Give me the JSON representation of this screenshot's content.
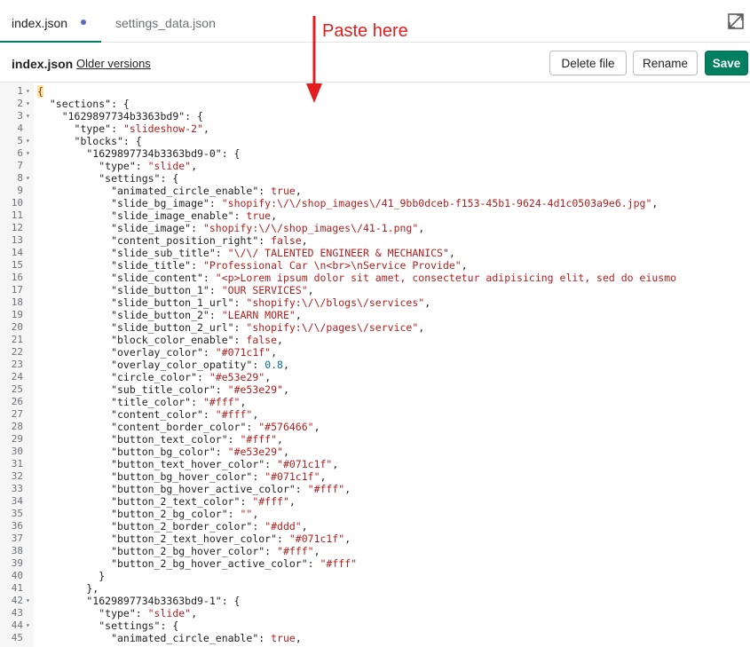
{
  "tabs": [
    {
      "label": "index.json",
      "active": true,
      "modified": true
    },
    {
      "label": "settings_data.json",
      "active": false
    }
  ],
  "toolbar": {
    "filename": "index.json",
    "older_versions": "Older versions",
    "delete_label": "Delete file",
    "rename_label": "Rename",
    "save_label": "Save"
  },
  "annotation": {
    "text": "Paste here",
    "color": "#e11d1d"
  },
  "colors": {
    "accent": "#008060",
    "string": "#b31d1d",
    "number": "#0a6e8a",
    "dot": "#5c6ac4"
  },
  "code_lines": [
    {
      "n": "1",
      "fold": true,
      "parts": [
        [
          "b",
          "{"
        ]
      ]
    },
    {
      "n": "2",
      "fold": true,
      "parts": [
        [
          "k",
          "  \"sections\": {"
        ]
      ]
    },
    {
      "n": "3",
      "fold": true,
      "parts": [
        [
          "k",
          "    \"1629897734b3363bd9\": {"
        ]
      ]
    },
    {
      "n": "4",
      "fold": false,
      "parts": [
        [
          "k",
          "      \"type\": "
        ],
        [
          "s",
          "\"slideshow-2\""
        ],
        [
          "k",
          ","
        ]
      ]
    },
    {
      "n": "5",
      "fold": true,
      "parts": [
        [
          "k",
          "      \"blocks\": {"
        ]
      ]
    },
    {
      "n": "6",
      "fold": true,
      "parts": [
        [
          "k",
          "        \"1629897734b3363bd9-0\": {"
        ]
      ]
    },
    {
      "n": "7",
      "fold": false,
      "parts": [
        [
          "k",
          "          \"type\": "
        ],
        [
          "s",
          "\"slide\""
        ],
        [
          "k",
          ","
        ]
      ]
    },
    {
      "n": "8",
      "fold": true,
      "parts": [
        [
          "k",
          "          \"settings\": {"
        ]
      ]
    },
    {
      "n": "9",
      "fold": false,
      "parts": [
        [
          "k",
          "            \"animated_circle_enable\": "
        ],
        [
          "b",
          "true"
        ],
        [
          "k",
          ","
        ]
      ]
    },
    {
      "n": "10",
      "fold": false,
      "parts": [
        [
          "k",
          "            \"slide_bg_image\": "
        ],
        [
          "s",
          "\"shopify:\\/\\/shop_images\\/41_9bb0dceb-f153-45b1-9624-4d1c0503a9e6.jpg\""
        ],
        [
          "k",
          ","
        ]
      ]
    },
    {
      "n": "11",
      "fold": false,
      "parts": [
        [
          "k",
          "            \"slide_image_enable\": "
        ],
        [
          "b",
          "true"
        ],
        [
          "k",
          ","
        ]
      ]
    },
    {
      "n": "12",
      "fold": false,
      "parts": [
        [
          "k",
          "            \"slide_image\": "
        ],
        [
          "s",
          "\"shopify:\\/\\/shop_images\\/41-1.png\""
        ],
        [
          "k",
          ","
        ]
      ]
    },
    {
      "n": "13",
      "fold": false,
      "parts": [
        [
          "k",
          "            \"content_position_right\": "
        ],
        [
          "b",
          "false"
        ],
        [
          "k",
          ","
        ]
      ]
    },
    {
      "n": "14",
      "fold": false,
      "parts": [
        [
          "k",
          "            \"slide_sub_title\": "
        ],
        [
          "s",
          "\"\\/\\/ TALENTED ENGINEER & MECHANICS\""
        ],
        [
          "k",
          ","
        ]
      ]
    },
    {
      "n": "15",
      "fold": false,
      "parts": [
        [
          "k",
          "            \"slide_title\": "
        ],
        [
          "s",
          "\"Professional Car \\n<br>\\nService Provide\""
        ],
        [
          "k",
          ","
        ]
      ]
    },
    {
      "n": "16",
      "fold": false,
      "parts": [
        [
          "k",
          "            \"slide_content\": "
        ],
        [
          "s",
          "\"<p>Lorem ipsum dolor sit amet, consectetur adipisicing elit, sed do eiusmo"
        ]
      ]
    },
    {
      "n": "17",
      "fold": false,
      "parts": [
        [
          "k",
          "            \"slide_button_1\": "
        ],
        [
          "s",
          "\"OUR SERVICES\""
        ],
        [
          "k",
          ","
        ]
      ]
    },
    {
      "n": "18",
      "fold": false,
      "parts": [
        [
          "k",
          "            \"slide_button_1_url\": "
        ],
        [
          "s",
          "\"shopify:\\/\\/blogs\\/services\""
        ],
        [
          "k",
          ","
        ]
      ]
    },
    {
      "n": "19",
      "fold": false,
      "parts": [
        [
          "k",
          "            \"slide_button_2\": "
        ],
        [
          "s",
          "\"LEARN MORE\""
        ],
        [
          "k",
          ","
        ]
      ]
    },
    {
      "n": "20",
      "fold": false,
      "parts": [
        [
          "k",
          "            \"slide_button_2_url\": "
        ],
        [
          "s",
          "\"shopify:\\/\\/pages\\/service\""
        ],
        [
          "k",
          ","
        ]
      ]
    },
    {
      "n": "21",
      "fold": false,
      "parts": [
        [
          "k",
          "            \"block_color_enable\": "
        ],
        [
          "b",
          "false"
        ],
        [
          "k",
          ","
        ]
      ]
    },
    {
      "n": "22",
      "fold": false,
      "parts": [
        [
          "k",
          "            \"overlay_color\": "
        ],
        [
          "s",
          "\"#071c1f\""
        ],
        [
          "k",
          ","
        ]
      ]
    },
    {
      "n": "23",
      "fold": false,
      "parts": [
        [
          "k",
          "            \"overlay_color_opatity\": "
        ],
        [
          "n",
          "0.8"
        ],
        [
          "k",
          ","
        ]
      ]
    },
    {
      "n": "24",
      "fold": false,
      "parts": [
        [
          "k",
          "            \"circle_color\": "
        ],
        [
          "s",
          "\"#e53e29\""
        ],
        [
          "k",
          ","
        ]
      ]
    },
    {
      "n": "25",
      "fold": false,
      "parts": [
        [
          "k",
          "            \"sub_title_color\": "
        ],
        [
          "s",
          "\"#e53e29\""
        ],
        [
          "k",
          ","
        ]
      ]
    },
    {
      "n": "26",
      "fold": false,
      "parts": [
        [
          "k",
          "            \"title_color\": "
        ],
        [
          "s",
          "\"#fff\""
        ],
        [
          "k",
          ","
        ]
      ]
    },
    {
      "n": "27",
      "fold": false,
      "parts": [
        [
          "k",
          "            \"content_color\": "
        ],
        [
          "s",
          "\"#fff\""
        ],
        [
          "k",
          ","
        ]
      ]
    },
    {
      "n": "28",
      "fold": false,
      "parts": [
        [
          "k",
          "            \"content_border_color\": "
        ],
        [
          "s",
          "\"#576466\""
        ],
        [
          "k",
          ","
        ]
      ]
    },
    {
      "n": "29",
      "fold": false,
      "parts": [
        [
          "k",
          "            \"button_text_color\": "
        ],
        [
          "s",
          "\"#fff\""
        ],
        [
          "k",
          ","
        ]
      ]
    },
    {
      "n": "30",
      "fold": false,
      "parts": [
        [
          "k",
          "            \"button_bg_color\": "
        ],
        [
          "s",
          "\"#e53e29\""
        ],
        [
          "k",
          ","
        ]
      ]
    },
    {
      "n": "31",
      "fold": false,
      "parts": [
        [
          "k",
          "            \"button_text_hover_color\": "
        ],
        [
          "s",
          "\"#071c1f\""
        ],
        [
          "k",
          ","
        ]
      ]
    },
    {
      "n": "32",
      "fold": false,
      "parts": [
        [
          "k",
          "            \"button_bg_hover_color\": "
        ],
        [
          "s",
          "\"#071c1f\""
        ],
        [
          "k",
          ","
        ]
      ]
    },
    {
      "n": "33",
      "fold": false,
      "parts": [
        [
          "k",
          "            \"button_bg_hover_active_color\": "
        ],
        [
          "s",
          "\"#fff\""
        ],
        [
          "k",
          ","
        ]
      ]
    },
    {
      "n": "34",
      "fold": false,
      "parts": [
        [
          "k",
          "            \"button_2_text_color\": "
        ],
        [
          "s",
          "\"#fff\""
        ],
        [
          "k",
          ","
        ]
      ]
    },
    {
      "n": "35",
      "fold": false,
      "parts": [
        [
          "k",
          "            \"button_2_bg_color\": "
        ],
        [
          "s",
          "\"\""
        ],
        [
          "k",
          ","
        ]
      ]
    },
    {
      "n": "36",
      "fold": false,
      "parts": [
        [
          "k",
          "            \"button_2_border_color\": "
        ],
        [
          "s",
          "\"#ddd\""
        ],
        [
          "k",
          ","
        ]
      ]
    },
    {
      "n": "37",
      "fold": false,
      "parts": [
        [
          "k",
          "            \"button_2_text_hover_color\": "
        ],
        [
          "s",
          "\"#071c1f\""
        ],
        [
          "k",
          ","
        ]
      ]
    },
    {
      "n": "38",
      "fold": false,
      "parts": [
        [
          "k",
          "            \"button_2_bg_hover_color\": "
        ],
        [
          "s",
          "\"#fff\""
        ],
        [
          "k",
          ","
        ]
      ]
    },
    {
      "n": "39",
      "fold": false,
      "parts": [
        [
          "k",
          "            \"button_2_bg_hover_active_color\": "
        ],
        [
          "s",
          "\"#fff\""
        ]
      ]
    },
    {
      "n": "40",
      "fold": false,
      "parts": [
        [
          "k",
          "          }"
        ]
      ]
    },
    {
      "n": "41",
      "fold": false,
      "parts": [
        [
          "k",
          "        },"
        ]
      ]
    },
    {
      "n": "42",
      "fold": true,
      "parts": [
        [
          "k",
          "        \"1629897734b3363bd9-1\": {"
        ]
      ]
    },
    {
      "n": "43",
      "fold": false,
      "parts": [
        [
          "k",
          "          \"type\": "
        ],
        [
          "s",
          "\"slide\""
        ],
        [
          "k",
          ","
        ]
      ]
    },
    {
      "n": "44",
      "fold": true,
      "parts": [
        [
          "k",
          "          \"settings\": {"
        ]
      ]
    },
    {
      "n": "45",
      "fold": false,
      "parts": [
        [
          "k",
          "            \"animated_circle_enable\": "
        ],
        [
          "b",
          "true"
        ],
        [
          "k",
          ","
        ]
      ]
    }
  ]
}
